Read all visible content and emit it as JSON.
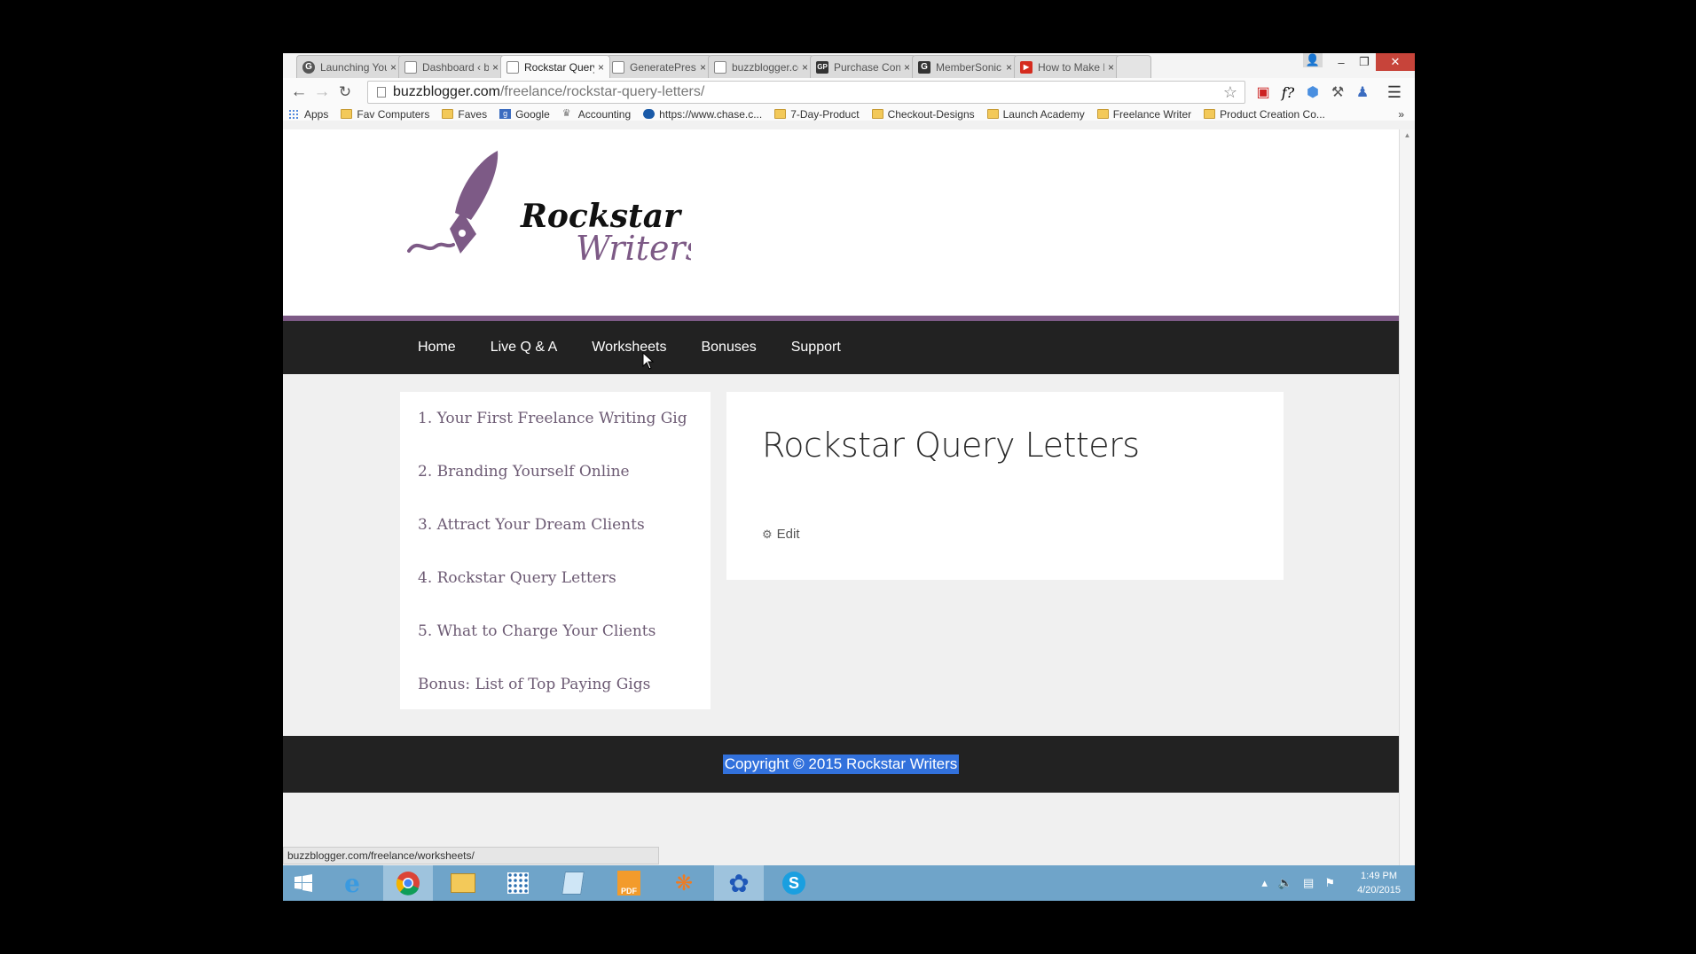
{
  "browser": {
    "tabs": [
      {
        "title": "Launching You",
        "icon": "google-g"
      },
      {
        "title": "Dashboard ‹ bu",
        "icon": "page"
      },
      {
        "title": "Rockstar Query",
        "icon": "page",
        "active": true
      },
      {
        "title": "GeneratePress",
        "icon": "page"
      },
      {
        "title": "buzzblogger.co",
        "icon": "page"
      },
      {
        "title": "Purchase Confi",
        "icon": "gp"
      },
      {
        "title": "MemberSonic",
        "icon": "g-dark"
      },
      {
        "title": "How to Make M",
        "icon": "youtube"
      }
    ],
    "tab_close": "×",
    "window_controls": {
      "minimize": "–",
      "restore": "❐",
      "close": "✕"
    },
    "url": {
      "host": "buzzblogger.com",
      "path": "/freelance/rockstar-query-letters/"
    },
    "bookmarks": [
      {
        "label": "Apps",
        "icon": "apps-grid"
      },
      {
        "label": "Fav Computers",
        "icon": "folder"
      },
      {
        "label": "Faves",
        "icon": "folder"
      },
      {
        "label": "Google",
        "icon": "google"
      },
      {
        "label": "Accounting",
        "icon": "accounting"
      },
      {
        "label": "https://www.chase.c...",
        "icon": "chase"
      },
      {
        "label": "7-Day-Product",
        "icon": "folder"
      },
      {
        "label": "Checkout-Designs",
        "icon": "folder"
      },
      {
        "label": "Launch Academy",
        "icon": "folder"
      },
      {
        "label": "Freelance Writer",
        "icon": "folder"
      },
      {
        "label": "Product Creation Co...",
        "icon": "folder"
      }
    ],
    "bookmarks_overflow": "»",
    "status_url": "buzzblogger.com/freelance/worksheets/"
  },
  "site": {
    "logo_line1": "Rockstar",
    "logo_line2": "Writers",
    "nav": [
      "Home",
      "Live Q & A",
      "Worksheets",
      "Bonuses",
      "Support"
    ],
    "sidebar": [
      "1. Your First Freelance Writing Gig",
      "2. Branding Yourself Online",
      "3. Attract Your Dream Clients",
      "4. Rockstar Query Letters",
      "5. What to Charge Your Clients",
      "Bonus: List of Top Paying Gigs"
    ],
    "page_title": "Rockstar Query Letters",
    "edit_label": "Edit",
    "footer": "Copyright © 2015 Rockstar Writers"
  },
  "taskbar": {
    "time": "1:49 PM",
    "date": "4/20/2015"
  },
  "colors": {
    "brand_purple": "#7d5a86",
    "nav_bg": "#222222",
    "selection": "#3271dc"
  }
}
